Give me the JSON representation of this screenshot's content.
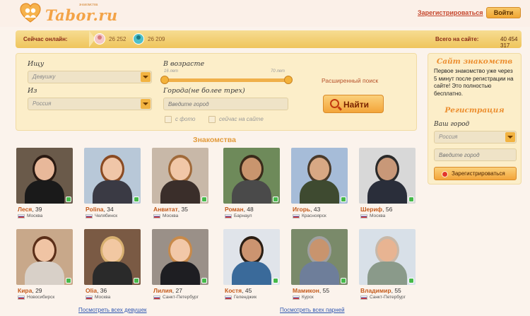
{
  "header": {
    "logo_text": "Tabor.ru",
    "logo_sub": "знакомства",
    "register_link": "Зарегистрироваться",
    "login_button": "Войти"
  },
  "online": {
    "label": "Сейчас онлайн:",
    "female_count": "26 252",
    "male_count": "26 209",
    "total_label": "Всего на сайте:",
    "total_value": "40 454 317"
  },
  "search": {
    "seek_label": "Ищу",
    "seek_value": "Девушку",
    "from_label": "Из",
    "from_value": "Россия",
    "age_label": "В возрасте",
    "age_min": "16 лет",
    "age_max": "70 лет",
    "cities_label": "Города(не более трех)",
    "city_placeholder": "Введите город",
    "with_photo": "с фото",
    "online_now": "сейчас на сайте",
    "advanced_link": "Расширенный поиск",
    "find_button": "Найти"
  },
  "dating": {
    "title": "Знакомства",
    "cards": [
      {
        "name": "Леся",
        "age": ", 39",
        "city": "Москва",
        "skin": "#e8b89a",
        "hair": "#2a1a12",
        "cloth": "#1a1a1a",
        "bg": "#6a5a4a"
      },
      {
        "name": "Polina",
        "age": ", 34",
        "city": "Челябинск",
        "skin": "#f0c6a8",
        "hair": "#8a4a22",
        "cloth": "#3a3a44",
        "bg": "#b8c8d8"
      },
      {
        "name": "Анвитат",
        "age": ", 35",
        "city": "Москва",
        "skin": "#f1c7a7",
        "hair": "#a06a3a",
        "cloth": "#3a2e2a",
        "bg": "#c8b8a8"
      },
      {
        "name": "Роман",
        "age": ", 48",
        "city": "Барнаул",
        "skin": "#c9956e",
        "hair": "#3a2a1a",
        "cloth": "#4a4a4a",
        "bg": "#6e8a5a"
      },
      {
        "name": "Игорь",
        "age": ", 43",
        "city": "Красноярск",
        "skin": "#d8a884",
        "hair": "#4a3a2a",
        "cloth": "#3e4a30",
        "bg": "#a6bcd8"
      },
      {
        "name": "Шериф",
        "age": ", 56",
        "city": "Москва",
        "skin": "#c89878",
        "hair": "#2a2a2a",
        "cloth": "#2a2e3a",
        "bg": "#d8d8d8"
      },
      {
        "name": "Кира",
        "age": ", 29",
        "city": "Новосибирск",
        "skin": "#f0c4a4",
        "hair": "#5a2e18",
        "cloth": "#d8d0c8",
        "bg": "#c8a88a"
      },
      {
        "name": "Olia",
        "age": ", 36",
        "city": "Москва",
        "skin": "#f2c8a2",
        "hair": "#d8b070",
        "cloth": "#2a2a2a",
        "bg": "#7a5a44"
      },
      {
        "name": "Лилия",
        "age": ", 27",
        "city": "Санкт-Петербург",
        "skin": "#f2c8a8",
        "hair": "#c88a4a",
        "cloth": "#1e1e22",
        "bg": "#9a9088"
      },
      {
        "name": "Костя",
        "age": ", 45",
        "city": "Геленджик",
        "skin": "#cc9470",
        "hair": "#2a1e14",
        "cloth": "#3a6a9a",
        "bg": "#e0e4ea"
      },
      {
        "name": "Мамикон",
        "age": ", 55",
        "city": "Курск",
        "skin": "#c8946e",
        "hair": "#a0a0a0",
        "cloth": "#6e7e9a",
        "bg": "#7a8a6a"
      },
      {
        "name": "Владимир",
        "age": ", 55",
        "city": "Санкт-Петербург",
        "skin": "#e8b492",
        "hair": "#c8b8a8",
        "cloth": "#8a9a8a",
        "bg": "#d8e0e8"
      }
    ],
    "see_all_girls": "Посмотреть всех девушек",
    "see_all_boys": "Посмотреть всех парней"
  },
  "sidebar": {
    "title": "Сайт знакомств",
    "text": "Первое знакомство уже через 5 минут после регистрации на сайте! Это полностью бесплатно.",
    "reg_title": "Регистрация",
    "city_label": "Ваш город",
    "country_value": "Россия",
    "city_placeholder": "Введите город",
    "register_button": "Зарегистрироваться"
  }
}
